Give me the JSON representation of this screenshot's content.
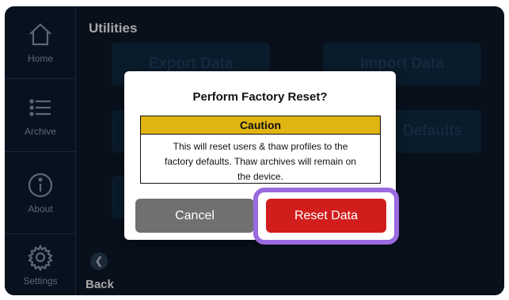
{
  "sidebar": {
    "items": [
      {
        "label": "Home",
        "icon": "home-icon"
      },
      {
        "label": "Archive",
        "icon": "list-icon"
      },
      {
        "label": "About",
        "icon": "info-icon"
      },
      {
        "label": "Settings",
        "icon": "gear-icon"
      }
    ]
  },
  "page": {
    "title": "Utilities",
    "buttons": {
      "export": "Export Data",
      "import": "Import Data",
      "defaults": "Defaults"
    },
    "back_label": "Back"
  },
  "dialog": {
    "title": "Perform Factory Reset?",
    "caution_heading": "Caution",
    "caution_line1": "This will reset users & thaw profiles to the",
    "caution_line2": "factory defaults. Thaw archives will remain on",
    "caution_line3": "the device.",
    "cancel_label": "Cancel",
    "confirm_label": "Reset Data"
  },
  "colors": {
    "screen_bg": "#0b1a2a",
    "caution": "#e0b512",
    "confirm": "#d21d1d",
    "cancel": "#707070",
    "highlight": "#9a6adf"
  }
}
